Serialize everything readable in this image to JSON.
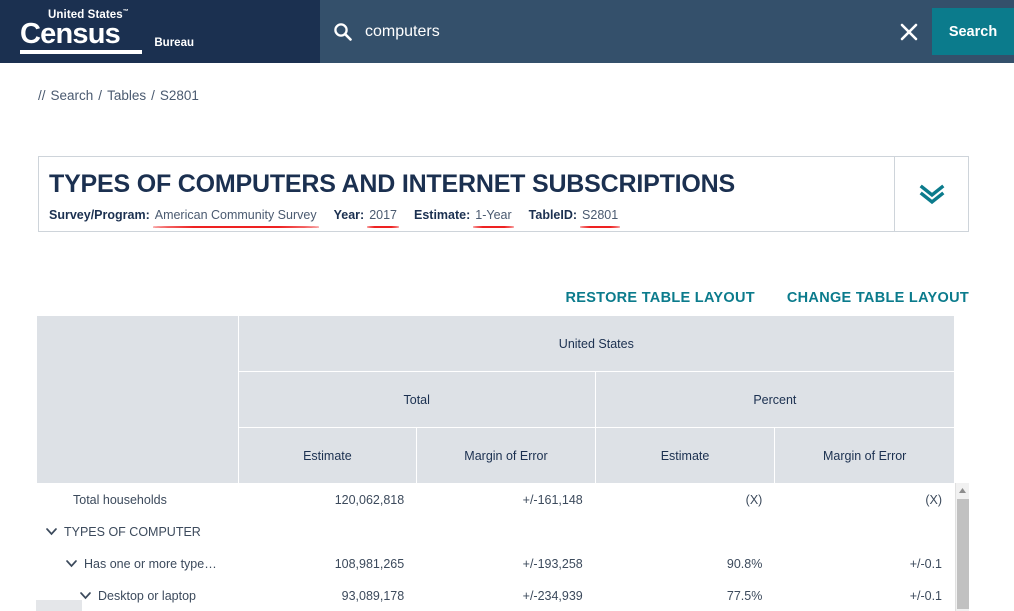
{
  "header": {
    "logo": {
      "line1": "United States",
      "trademark": "™",
      "line2": "Census",
      "line3": "Bureau"
    },
    "search": {
      "icon": "search-icon",
      "value": "computers",
      "placeholder": "Search",
      "clear_icon": "close-icon",
      "button_label": "Search"
    },
    "colors": {
      "logo_bg": "#1b3050",
      "search_bg": "#34506b",
      "accent_teal": "#0b7b8c"
    }
  },
  "breadcrumb": {
    "prefix": "//",
    "items": [
      "Search",
      "Tables",
      "S2801"
    ],
    "separator": "/"
  },
  "title_card": {
    "heading": "TYPES OF COMPUTERS AND INTERNET SUBSCRIPTIONS",
    "meta": [
      {
        "label": "Survey/Program:",
        "value": "American Community Survey",
        "underlined": true
      },
      {
        "label": "Year:",
        "value": "2017",
        "underlined": true
      },
      {
        "label": "Estimate:",
        "value": "1-Year",
        "underlined": true
      },
      {
        "label": "TableID:",
        "value": "S2801",
        "underlined": true
      }
    ],
    "expand_icon": "double-chevron-down-icon",
    "underline_color": "#ee2222"
  },
  "layout_actions": {
    "restore_label": "RESTORE TABLE LAYOUT",
    "change_label": "CHANGE TABLE LAYOUT"
  },
  "table": {
    "geo_header": "United States",
    "group_headers": [
      "Total",
      "Percent"
    ],
    "sub_headers": [
      "Estimate",
      "Margin of Error",
      "Estimate",
      "Margin of Error"
    ],
    "rows": [
      {
        "label": "Total households",
        "indent": 0,
        "expandable": false,
        "values": [
          "120,062,818",
          "+/-161,148",
          "(X)",
          "(X)"
        ]
      },
      {
        "label": "TYPES OF COMPUTER",
        "indent": 0,
        "expandable": true,
        "icon": "chevron-down-icon",
        "values": [
          "",
          "",
          "",
          ""
        ]
      },
      {
        "label": "Has one or more type…",
        "indent": 1,
        "expandable": true,
        "icon": "chevron-down-icon",
        "values": [
          "108,981,265",
          "+/-193,258",
          "90.8%",
          "+/-0.1"
        ]
      },
      {
        "label": "Desktop or laptop",
        "indent": 2,
        "expandable": true,
        "icon": "chevron-down-icon",
        "values": [
          "93,089,178",
          "+/-234,939",
          "77.5%",
          "+/-0.1"
        ]
      }
    ],
    "scrollbar": {
      "vertical_up_icon": "scroll-up-arrow-icon",
      "horizontal": "horizontal-scrollbar"
    }
  }
}
